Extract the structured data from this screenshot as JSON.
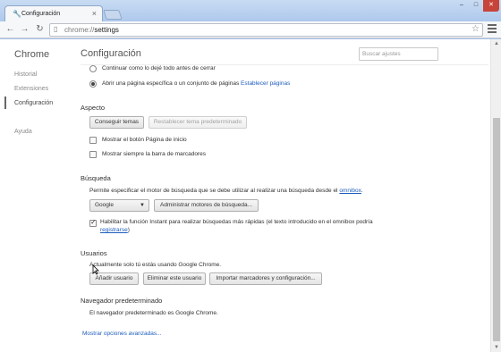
{
  "window": {
    "tab_title": "Configuración",
    "tab_icon": "wrench-icon",
    "minimize": "–",
    "maximize": "□",
    "close": "✕"
  },
  "toolbar": {
    "url_scheme": "chrome://",
    "url_path": "settings"
  },
  "sidebar": {
    "title": "Chrome",
    "items": [
      {
        "label": "Historial"
      },
      {
        "label": "Extensiones"
      },
      {
        "label": "Configuración"
      },
      {
        "label": "Ayuda"
      }
    ]
  },
  "main": {
    "title": "Configuración",
    "search_placeholder": "Buscar ajustes",
    "startup": {
      "option_continue": "Continuar como lo dejé todo antes de cerrar",
      "option_pages": "Abrir una página específica o un conjunto de páginas",
      "set_pages_link": "Establecer páginas"
    },
    "appearance": {
      "heading": "Aspecto",
      "get_themes": "Conseguir temas",
      "reset_theme": "Restablecer tema predeterminado",
      "show_home_button": "Mostrar el botón Página de inicio",
      "show_bookmarks_bar": "Mostrar siempre la barra de marcadores"
    },
    "search": {
      "heading": "Búsqueda",
      "description": "Permite especificar el motor de búsqueda que se debe utilizar al realizar una búsqueda desde el",
      "omnibox_link": "omnibox",
      "description_end": ".",
      "engine_selected": "Google",
      "manage_engines": "Administrar motores de búsqueda...",
      "instant_label": "Habilitar la función Instant para realizar búsquedas más rápidas (el texto introducido en el omnibox podría",
      "instant_link": "registrarse",
      "instant_end": ")"
    },
    "users": {
      "heading": "Usuarios",
      "description": "Actualmente solo tú estás usando Google Chrome.",
      "add_user": "Añadir usuario",
      "delete_user": "Eliminar este usuario",
      "import": "Importar marcadores y configuración..."
    },
    "default_browser": {
      "heading": "Navegador predeterminado",
      "description": "El navegador predeterminado es Google Chrome."
    },
    "advanced_link": "Mostrar opciones avanzadas..."
  },
  "state": {
    "startup_selected": "option_pages",
    "show_home_button": false,
    "show_bookmarks_bar": false,
    "instant_enabled": true
  }
}
